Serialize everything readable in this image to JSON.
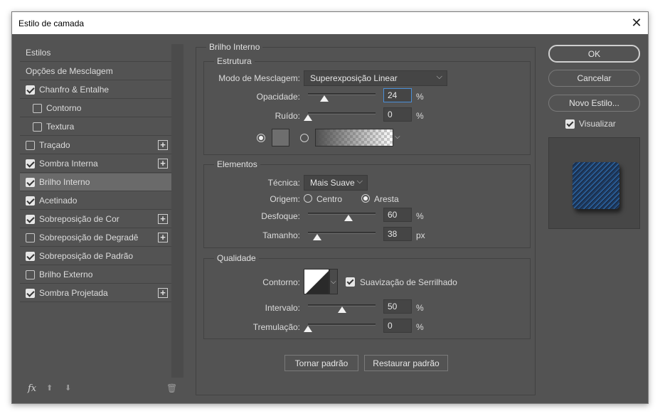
{
  "window": {
    "title": "Estilo de camada",
    "close_glyph": "✕"
  },
  "styles_list": {
    "items": [
      {
        "label": "Estilos",
        "checkbox": false,
        "checked": false,
        "plus": false,
        "indent": false
      },
      {
        "label": "Opções de Mesclagem",
        "checkbox": false,
        "checked": false,
        "plus": false,
        "indent": false
      },
      {
        "label": "Chanfro & Entalhe",
        "checkbox": true,
        "checked": true,
        "plus": false,
        "indent": false
      },
      {
        "label": "Contorno",
        "checkbox": true,
        "checked": false,
        "plus": false,
        "indent": true
      },
      {
        "label": "Textura",
        "checkbox": true,
        "checked": false,
        "plus": false,
        "indent": true
      },
      {
        "label": "Traçado",
        "checkbox": true,
        "checked": false,
        "plus": true,
        "indent": false
      },
      {
        "label": "Sombra Interna",
        "checkbox": true,
        "checked": true,
        "plus": true,
        "indent": false
      },
      {
        "label": "Brilho Interno",
        "checkbox": true,
        "checked": true,
        "plus": false,
        "indent": false,
        "selected": true
      },
      {
        "label": "Acetinado",
        "checkbox": true,
        "checked": true,
        "plus": false,
        "indent": false
      },
      {
        "label": "Sobreposição de Cor",
        "checkbox": true,
        "checked": true,
        "plus": true,
        "indent": false
      },
      {
        "label": "Sobreposição de Degradê",
        "checkbox": true,
        "checked": false,
        "plus": true,
        "indent": false
      },
      {
        "label": "Sobreposição de Padrão",
        "checkbox": true,
        "checked": true,
        "plus": false,
        "indent": false
      },
      {
        "label": "Brilho Externo",
        "checkbox": true,
        "checked": false,
        "plus": false,
        "indent": false
      },
      {
        "label": "Sombra Projetada",
        "checkbox": true,
        "checked": true,
        "plus": true,
        "indent": false
      }
    ],
    "footer": {
      "fx": "fx",
      "up": "⬆",
      "down": "⬇",
      "trash": "🗑"
    }
  },
  "inner_glow": {
    "title": "Brilho Interno",
    "structure": {
      "title": "Estrutura",
      "blend_mode_label": "Modo de Mesclagem:",
      "blend_mode_value": "Superexposição Linear",
      "opacity_label": "Opacidade:",
      "opacity_value": "24",
      "opacity_fraction": 0.24,
      "noise_label": "Ruído:",
      "noise_value": "0",
      "noise_fraction": 0.0,
      "percent": "%"
    },
    "elements": {
      "title": "Elementos",
      "technique_label": "Técnica:",
      "technique_value": "Mais Suave",
      "source_label": "Origem:",
      "source_center": "Centro",
      "source_edge": "Aresta",
      "choke_label": "Desfoque:",
      "choke_value": "60",
      "choke_fraction": 0.6,
      "size_label": "Tamanho:",
      "size_value": "38",
      "size_fraction": 0.14,
      "percent": "%",
      "px": "px"
    },
    "quality": {
      "title": "Qualidade",
      "contour_label": "Contorno:",
      "antialias_label": "Suavização de Serrilhado",
      "range_label": "Intervalo:",
      "range_value": "50",
      "range_fraction": 0.5,
      "jitter_label": "Tremulação:",
      "jitter_value": "0",
      "jitter_fraction": 0.0,
      "percent": "%"
    },
    "make_default": "Tornar padrão",
    "reset_default": "Restaurar padrão"
  },
  "right_buttons": {
    "ok": "OK",
    "cancel": "Cancelar",
    "new_style": "Novo Estilo...",
    "preview_label": "Visualizar"
  },
  "icons": {
    "chevron": "⌵"
  }
}
